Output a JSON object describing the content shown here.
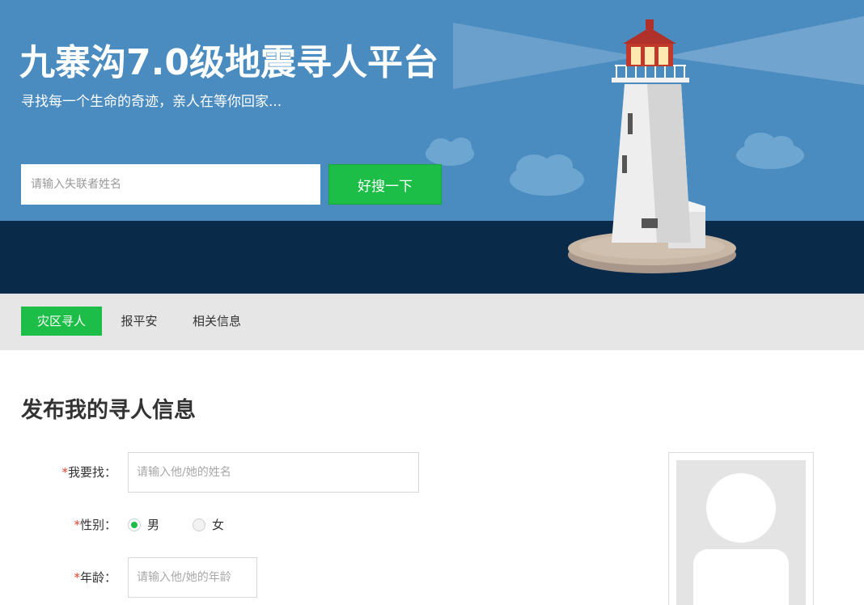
{
  "hero": {
    "title": "九寨沟7.0级地震寻人平台",
    "subtitle": "寻找每一个生命的奇迹，亲人在等你回家...",
    "search_placeholder": "请输入失联者姓名",
    "search_button": "好搜一下"
  },
  "tabs": [
    {
      "label": "灾区寻人",
      "active": true
    },
    {
      "label": "报平安",
      "active": false
    },
    {
      "label": "相关信息",
      "active": false
    }
  ],
  "form": {
    "title": "发布我的寻人信息",
    "required_mark": "*",
    "name_label": "我要找：",
    "name_placeholder": "请输入他/她的姓名",
    "gender_label": "性别：",
    "gender_options": [
      "男",
      "女"
    ],
    "gender_selected": "男",
    "age_label": "年龄：",
    "age_placeholder": "请输入他/她的年龄"
  },
  "photo": {
    "icon": "avatar-placeholder-icon"
  },
  "colors": {
    "accent_green": "#1dbe47",
    "sky_blue": "#4a8bc0",
    "sea_navy": "#0a2a4a",
    "tab_bar_gray": "#e6e6e6",
    "required_red": "#e0432e"
  }
}
